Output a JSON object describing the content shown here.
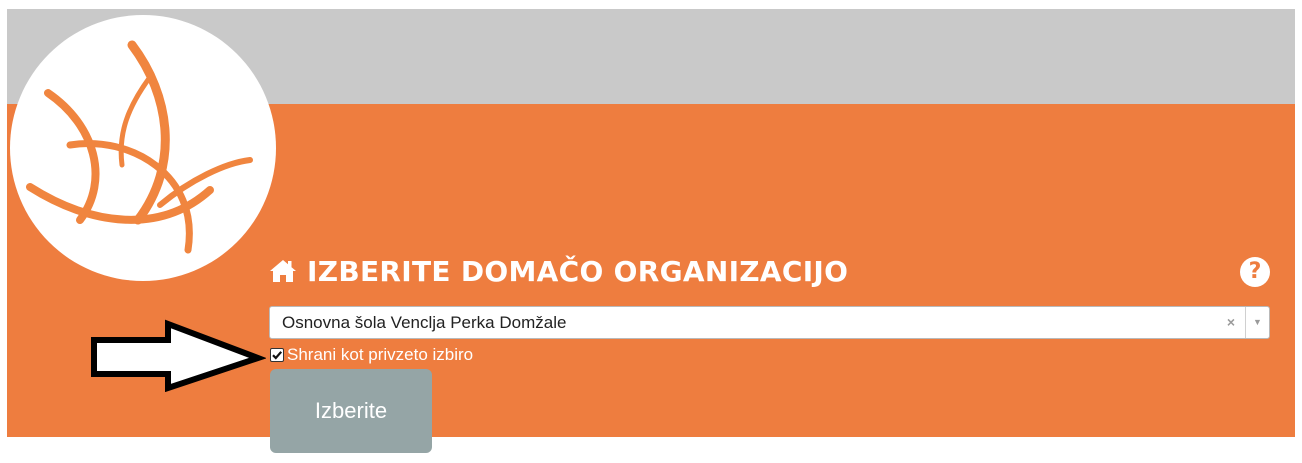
{
  "header": {
    "title": "IZBERITE DOMAČO ORGANIZACIJO",
    "home_icon": "home-icon",
    "help_icon": "question-circle-icon",
    "help_glyph": "?"
  },
  "organization_select": {
    "selected_value": "Osnovna šola Venclja Perka Domžale",
    "clear_glyph": "×",
    "arrow_glyph": "▼"
  },
  "remember_choice": {
    "label": "Shrani kot privzeto izbiro",
    "checked": true
  },
  "submit_button": {
    "label": "Izberite"
  },
  "colors": {
    "header_band": "#c9c9c9",
    "panel": "#ee7d3f",
    "logo_stroke": "#f0853f",
    "button": "#95a5a6"
  }
}
